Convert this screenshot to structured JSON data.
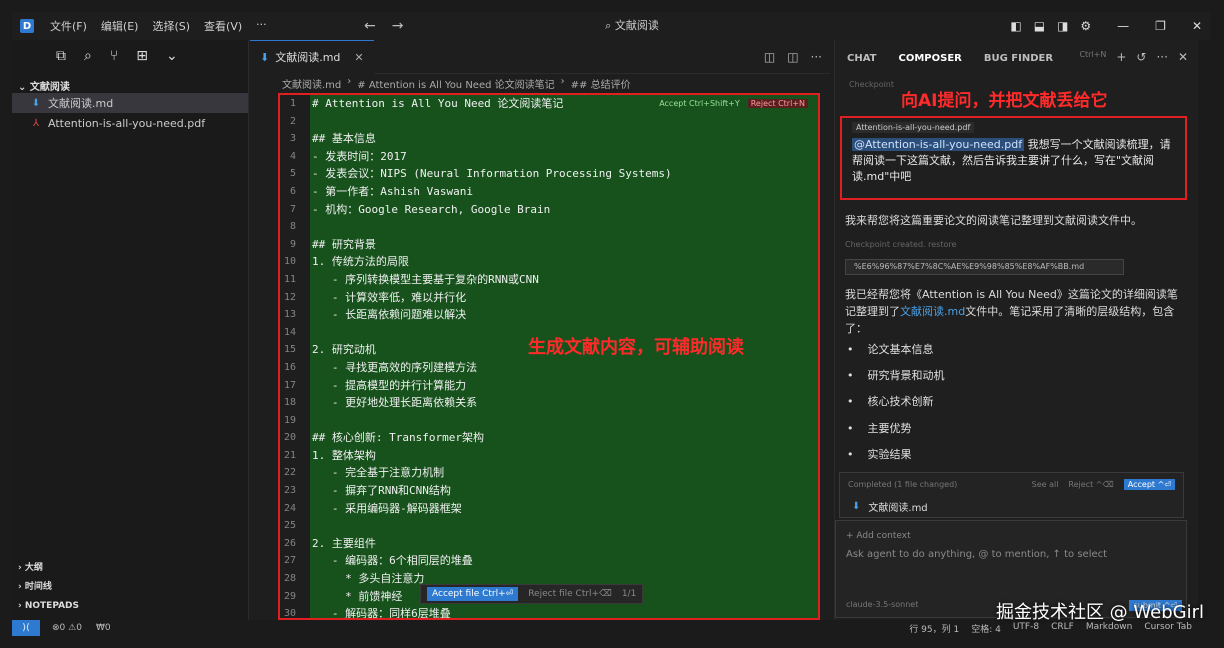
{
  "titlebar": {
    "app_icon": "D",
    "menu": [
      "文件(F)",
      "编辑(E)",
      "选择(S)",
      "查看(V)",
      "···"
    ],
    "search_text": "⌕ 文献阅读",
    "nav_back": "←",
    "nav_forward": "→"
  },
  "sidebar": {
    "folder": "文献阅读",
    "files": [
      {
        "name": "文献阅读.md",
        "icon": "markdown-icon"
      },
      {
        "name": "Attention-is-all-you-need.pdf",
        "icon": "pdf-icon"
      }
    ],
    "sections": [
      "大纲",
      "时间线",
      "NOTEPADS"
    ]
  },
  "editor": {
    "tab_label": "文献阅读.md",
    "breadcrumb": [
      "文献阅读.md",
      "# Attention is All You Need 论文阅读笔记",
      "## 总结评价"
    ],
    "accept_hint": "Accept Ctrl+Shift+Y",
    "reject_hint": "Reject Ctrl+N",
    "lines": [
      {
        "n": "1",
        "t": "# Attention is All You Need 论文阅读笔记"
      },
      {
        "n": "2",
        "t": ""
      },
      {
        "n": "3",
        "t": "## 基本信息"
      },
      {
        "n": "4",
        "t": "- 发表时间：2017"
      },
      {
        "n": "5",
        "t": "- 发表会议：NIPS (Neural Information Processing Systems)"
      },
      {
        "n": "6",
        "t": "- 第一作者：Ashish Vaswani"
      },
      {
        "n": "7",
        "t": "- 机构：Google Research, Google Brain"
      },
      {
        "n": "8",
        "t": ""
      },
      {
        "n": "9",
        "t": "## 研究背景"
      },
      {
        "n": "10",
        "t": "1. 传统方法的局限"
      },
      {
        "n": "11",
        "t": "   - 序列转换模型主要基于复杂的RNN或CNN"
      },
      {
        "n": "12",
        "t": "   - 计算效率低，难以并行化"
      },
      {
        "n": "13",
        "t": "   - 长距离依赖问题难以解决"
      },
      {
        "n": "14",
        "t": ""
      },
      {
        "n": "15",
        "t": "2. 研究动机"
      },
      {
        "n": "16",
        "t": "   - 寻找更高效的序列建模方法"
      },
      {
        "n": "17",
        "t": "   - 提高模型的并行计算能力"
      },
      {
        "n": "18",
        "t": "   - 更好地处理长距离依赖关系"
      },
      {
        "n": "19",
        "t": ""
      },
      {
        "n": "20",
        "t": "## 核心创新: Transformer架构"
      },
      {
        "n": "21",
        "t": "1. 整体架构"
      },
      {
        "n": "22",
        "t": "   - 完全基于注意力机制"
      },
      {
        "n": "23",
        "t": "   - 摒弃了RNN和CNN结构"
      },
      {
        "n": "24",
        "t": "   - 采用编码器-解码器框架"
      },
      {
        "n": "25",
        "t": ""
      },
      {
        "n": "26",
        "t": "2. 主要组件"
      },
      {
        "n": "27",
        "t": "   - 编码器：6个相同层的堆叠"
      },
      {
        "n": "28",
        "t": "     * 多头自注意力"
      },
      {
        "n": "29",
        "t": "     * 前馈神经"
      },
      {
        "n": "30",
        "t": "   - 解码器：同样6层堆叠"
      }
    ],
    "annotation": "生成文献内容，可辅助阅读",
    "accept_file": "Accept file Ctrl+⏎",
    "reject_file": "Reject file Ctrl+⌫",
    "file_counter": "1/1"
  },
  "panel": {
    "tabs": [
      "CHAT",
      "COMPOSER",
      "BUG FINDER"
    ],
    "shortcut": "Ctrl+N",
    "checkpoint_top": "Checkpoint",
    "annotation": "向AI提问，并把文献丢给它",
    "pdf_chip": "Attention-is-all-you-need.pdf",
    "mention": "@Attention-is-all-you-need.pdf",
    "prompt": " 我想写一个文献阅读梳理，请帮阅读一下这篇文献，然后告诉我主要讲了什么，写在\"文献阅读.md\"中吧",
    "reply1": "我来帮您将这篇重要论文的阅读笔记整理到文献阅读文件中。",
    "checkpoint2": "Checkpoint created. restore",
    "file_pill": "%E6%96%87%E7%8C%AE%E9%98%85%E8%AF%BB.md",
    "reply2_a": "我已经帮您将《Attention is All You Need》这篇论文的详细阅读笔记整理到了",
    "reply2_link": "文献阅读.md",
    "reply2_b": "文件中。笔记采用了清晰的层级结构，包含了：",
    "bullets": [
      "论文基本信息",
      "研究背景和动机",
      "核心技术创新",
      "主要优势",
      "实验结果"
    ],
    "changes_head": "Completed (1 file changed)",
    "see_all": "See all",
    "reject_all": "Reject ^⌫",
    "accept_all": "Accept ^⏎",
    "changed_file": "文献阅读.md",
    "add_context": "+ Add context",
    "input_placeholder": "Ask agent to do anything, @ to mention, ↑ to select",
    "model": "claude-3.5-sonnet",
    "submit": "submit ^⏎"
  },
  "statusbar": {
    "left": [
      "⊗0 ⚠0",
      "₩0"
    ],
    "right": [
      "行 95，列 1",
      "空格: 4",
      "UTF-8",
      "CRLF",
      "Markdown",
      "Cursor Tab"
    ]
  },
  "watermark": "掘金技术社区 @ WebGirl"
}
